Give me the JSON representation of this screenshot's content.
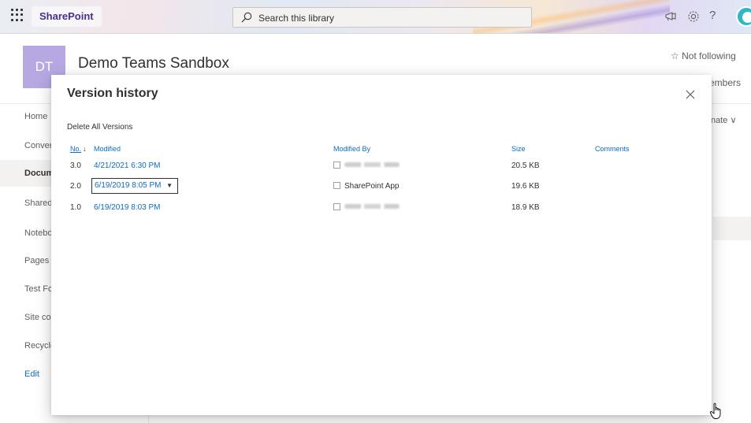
{
  "suite_bar": {
    "app_name": "SharePoint",
    "search_placeholder": "Search this library",
    "help_label": "?"
  },
  "site": {
    "logo_initials": "DT",
    "title": "Demo Teams Sandbox",
    "follow_label": "Not following",
    "members_label": "embers",
    "partial_command": "nate"
  },
  "nav": {
    "items": [
      {
        "label": "Home"
      },
      {
        "label": "Conver"
      },
      {
        "label": "Docum"
      },
      {
        "label": "Shared"
      },
      {
        "label": "Notebo"
      },
      {
        "label": "Pages"
      },
      {
        "label": "Test Fo"
      },
      {
        "label": "Site co"
      },
      {
        "label": "Recycle"
      },
      {
        "label": "Edit"
      }
    ]
  },
  "dialog": {
    "title": "Version history",
    "delete_all_label": "Delete All Versions",
    "columns": {
      "no": "No.",
      "sort_arrow": "↓",
      "modified": "Modified",
      "modified_by": "Modified By",
      "size": "Size",
      "comments": "Comments"
    },
    "rows": [
      {
        "no": "3.0",
        "modified": "4/21/2021 6:30 PM",
        "modified_by": "",
        "size": "20.5 KB",
        "comments": ""
      },
      {
        "no": "2.0",
        "modified": "6/19/2019 8:05 PM",
        "modified_by": "SharePoint App",
        "size": "19.6 KB",
        "comments": ""
      },
      {
        "no": "1.0",
        "modified": "6/19/2019 8:03 PM",
        "modified_by": "",
        "size": "18.9 KB",
        "comments": ""
      }
    ]
  },
  "colors": {
    "accent_blue": "#0f6cbd",
    "brand_purple": "#4b2f8f",
    "site_logo_bg": "#b7a8e3",
    "avatar_bg": "#2fb7c9"
  }
}
